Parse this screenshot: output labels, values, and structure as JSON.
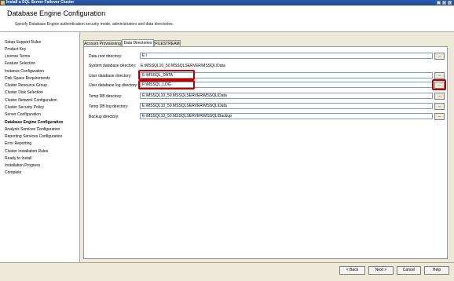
{
  "window": {
    "title": "Install a SQL Server Failover Cluster",
    "controls": [
      "_",
      "□",
      "×"
    ]
  },
  "header": {
    "title": "Database Engine Configuration",
    "subtitle": "Specify Database Engine authentication security mode, administrators and data directories."
  },
  "nav": {
    "items": [
      "Setup Support Rules",
      "Product Key",
      "License Terms",
      "Feature Selection",
      "Instance Configuration",
      "Disk Space Requirements",
      "Cluster Resource Group",
      "Cluster Disk Selection",
      "Cluster Network Configuration",
      "Cluster Security Policy",
      "Server Configuration",
      "Database Engine Configuration",
      "Analysis Services Configuration",
      "Reporting Services Configuration",
      "Error Reporting",
      "Cluster Installation Rules",
      "Ready to Install",
      "Installation Progress",
      "Complete"
    ],
    "active": "Database Engine Configuration"
  },
  "tabs": [
    "Account Provisioning",
    "Data Directories",
    "FILESTREAM"
  ],
  "active_tab": "Data Directories",
  "fields": {
    "data_root": {
      "label": "Data root directory:",
      "value": "E:\\"
    },
    "system_db": {
      "label": "System database directory:",
      "value": "E:\\MSSQL10_50.MSSQLSERVER\\MSSQL\\Data"
    },
    "user_db": {
      "label": "User database directory:",
      "value": "E:\\MSSQL_DATA"
    },
    "user_db_log": {
      "label": "User database log directory:",
      "value": "F:\\MSSQL_LOG"
    },
    "temp_db": {
      "label": "Temp DB directory:",
      "value": "E:\\MSSQL10_50.MSSQLSERVER\\MSSQL\\Data"
    },
    "temp_db_log": {
      "label": "Temp DB log directory:",
      "value": "E:\\MSSQL10_50.MSSQLSERVER\\MSSQL\\Data"
    },
    "backup": {
      "label": "Backup directory:",
      "value": "E:\\MSSQL10_50.MSSQLSERVER\\MSSQL\\Backup"
    }
  },
  "browse_label": "...",
  "buttons": {
    "back": "< Back",
    "next": "Next >",
    "cancel": "Cancel",
    "help": "Help"
  },
  "colors": {
    "highlight": "#c00000",
    "titlebar": "#2a5aa8"
  }
}
